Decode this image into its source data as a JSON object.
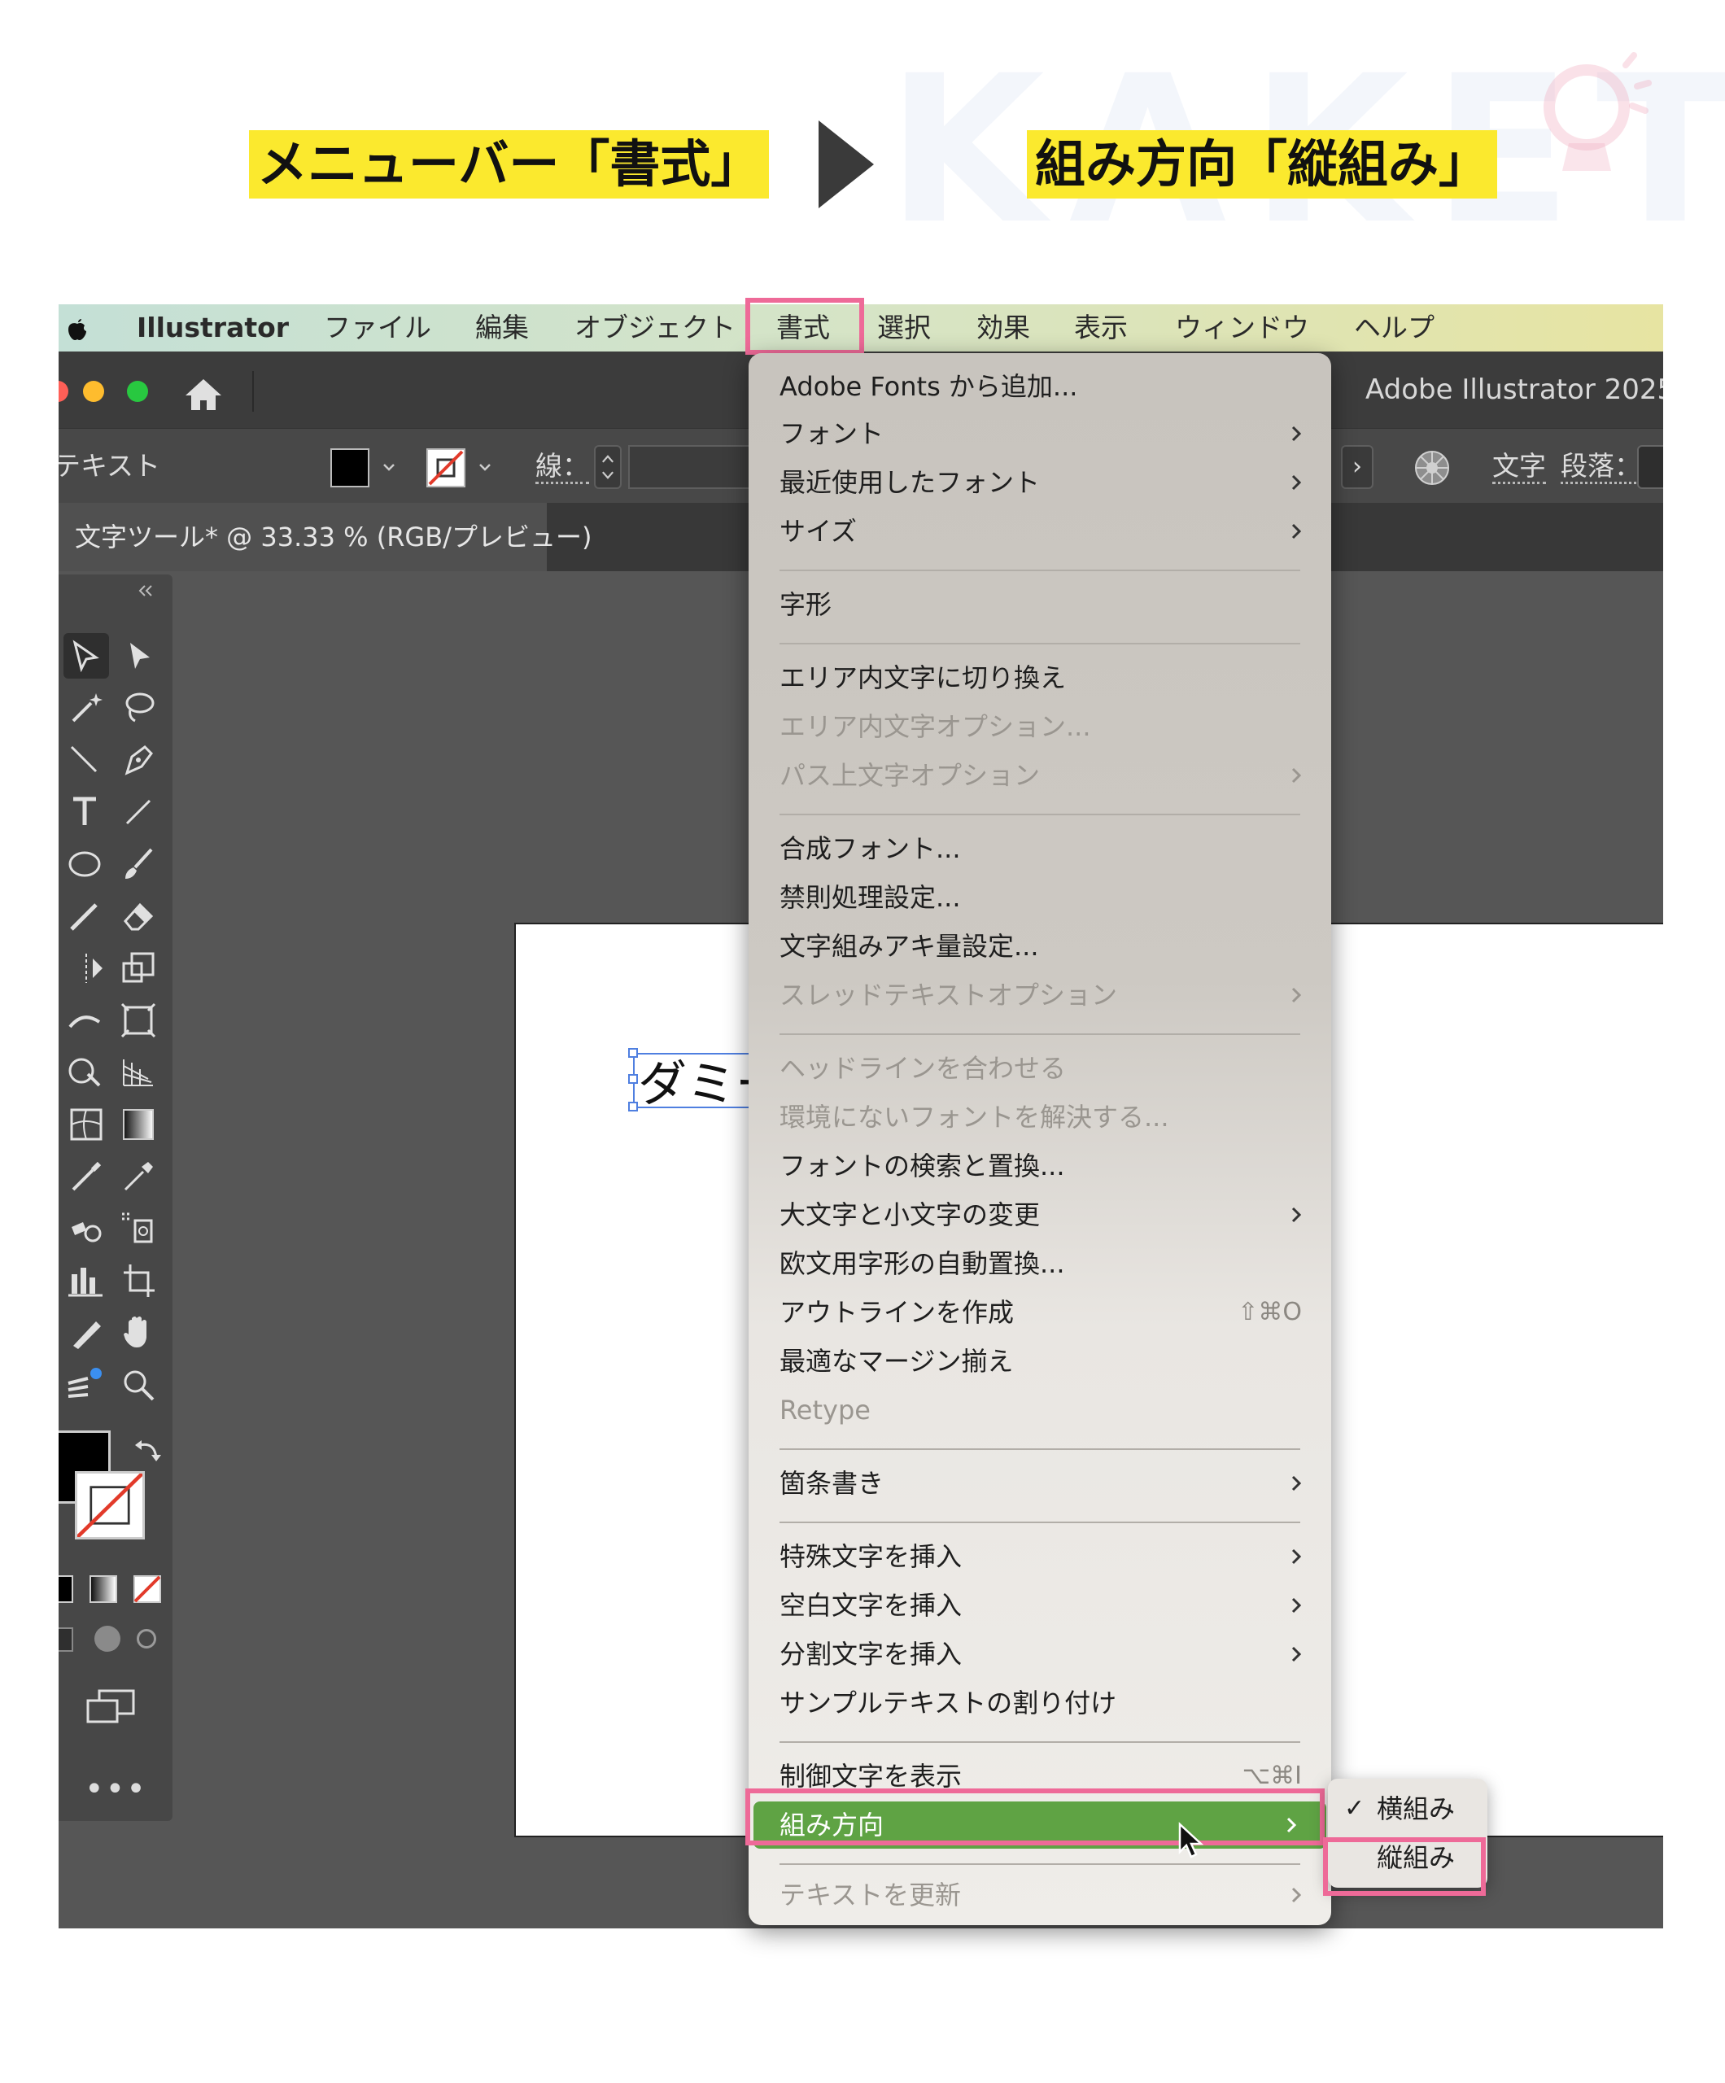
{
  "heading": {
    "left_label": "メニューバー「書式」",
    "right_label": "組み方向「縦組み」",
    "watermark": "KAKETA"
  },
  "menubar": {
    "app": "Illustrator",
    "items": [
      "ファイル",
      "編集",
      "オブジェクト",
      "書式",
      "選択",
      "効果",
      "表示",
      "ウィンドウ",
      "ヘルプ"
    ],
    "highlighted": "書式"
  },
  "window": {
    "title": "Adobe Illustrator 2025",
    "traffic_lights": [
      "#ff5f57",
      "#febc2e",
      "#28c840"
    ]
  },
  "control_bar": {
    "mode_label": "テキスト",
    "stroke_label": "線：",
    "char_label": "文字",
    "para_label": "段落："
  },
  "document_tab": {
    "label": "文字ツール* @ 33.33 % (RGB/プレビュー)"
  },
  "canvas": {
    "sample_text": "ダミー"
  },
  "format_menu": {
    "items": [
      {
        "label": "Adobe Fonts から追加...",
        "enabled": true,
        "submenu": false
      },
      {
        "label": "フォント",
        "enabled": true,
        "submenu": true
      },
      {
        "label": "最近使用したフォント",
        "enabled": true,
        "submenu": true
      },
      {
        "label": "サイズ",
        "enabled": true,
        "submenu": true
      },
      {
        "label": "字形",
        "enabled": true,
        "submenu": false
      },
      {
        "label": "エリア内文字に切り換え",
        "enabled": true,
        "submenu": false
      },
      {
        "label": "エリア内文字オプション...",
        "enabled": false,
        "submenu": false
      },
      {
        "label": "パス上文字オプション",
        "enabled": false,
        "submenu": true
      },
      {
        "label": "合成フォント...",
        "enabled": true,
        "submenu": false
      },
      {
        "label": "禁則処理設定...",
        "enabled": true,
        "submenu": false
      },
      {
        "label": "文字組みアキ量設定...",
        "enabled": true,
        "submenu": false
      },
      {
        "label": "スレッドテキストオプション",
        "enabled": false,
        "submenu": true
      },
      {
        "label": "ヘッドラインを合わせる",
        "enabled": false,
        "submenu": false
      },
      {
        "label": "環境にないフォントを解決する...",
        "enabled": false,
        "submenu": false
      },
      {
        "label": "フォントの検索と置換...",
        "enabled": true,
        "submenu": false
      },
      {
        "label": "大文字と小文字の変更",
        "enabled": true,
        "submenu": true
      },
      {
        "label": "欧文用字形の自動置換...",
        "enabled": true,
        "submenu": false
      },
      {
        "label": "アウトラインを作成",
        "enabled": true,
        "submenu": false,
        "shortcut": "⇧⌘O"
      },
      {
        "label": "最適なマージン揃え",
        "enabled": true,
        "submenu": false
      },
      {
        "label": "Retype",
        "enabled": false,
        "submenu": false
      },
      {
        "label": "箇条書き",
        "enabled": true,
        "submenu": true
      },
      {
        "label": "特殊文字を挿入",
        "enabled": true,
        "submenu": true
      },
      {
        "label": "空白文字を挿入",
        "enabled": true,
        "submenu": true
      },
      {
        "label": "分割文字を挿入",
        "enabled": true,
        "submenu": true
      },
      {
        "label": "サンプルテキストの割り付け",
        "enabled": true,
        "submenu": false
      },
      {
        "label": "制御文字を表示",
        "enabled": true,
        "submenu": false,
        "shortcut": "⌥⌘I"
      },
      {
        "label": "組み方向",
        "enabled": true,
        "submenu": true,
        "selected": true
      },
      {
        "label": "テキストを更新",
        "enabled": false,
        "submenu": true
      }
    ]
  },
  "orientation_submenu": {
    "items": [
      {
        "label": "横組み",
        "checked": true
      },
      {
        "label": "縦組み",
        "checked": false,
        "highlighted": true
      }
    ]
  },
  "colors": {
    "highlight_yellow": "#fbe92e",
    "annotation_pink": "#ee6a98",
    "menu_selection_green": "#5fa344"
  }
}
